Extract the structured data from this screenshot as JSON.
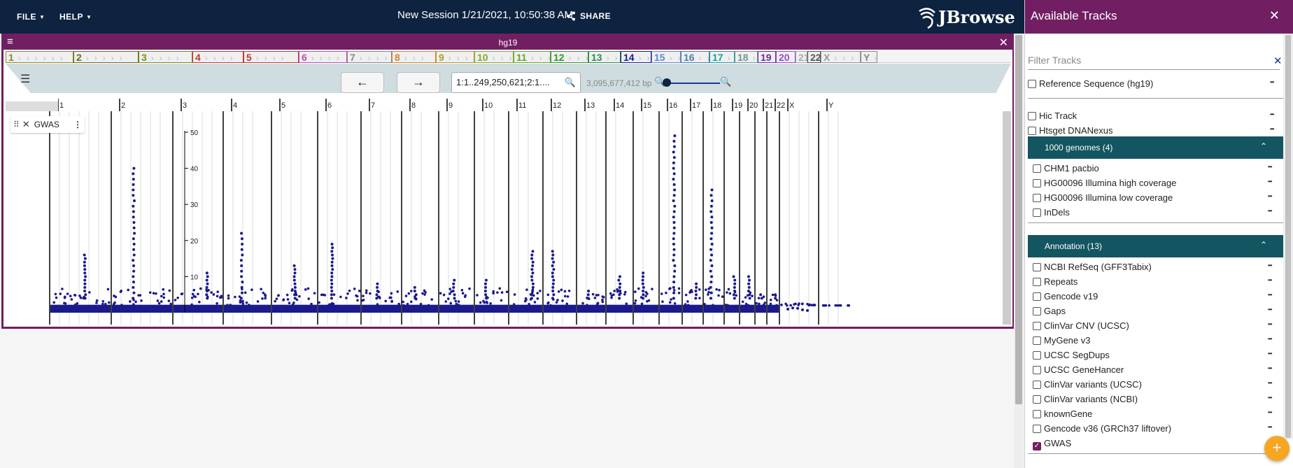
{
  "header": {
    "file_menu": "FILE",
    "help_menu": "HELP",
    "session_title": "New Session 1/21/2021, 10:50:38 AM",
    "share_label": "SHARE",
    "logo_text": "JBrowse",
    "colors": {
      "header_bg": "#0d233f",
      "accent": "#721e63",
      "teal": "#135560",
      "fab": "#f5a623"
    }
  },
  "view": {
    "assembly": "hg19",
    "location": "1:1..249,250,621;2:1....",
    "bp_count": "3,095,677,412 bp",
    "track_label": "GWAS",
    "chromosomes": [
      "1",
      "2",
      "3",
      "4",
      "5",
      "6",
      "7",
      "8",
      "9",
      "10",
      "11",
      "12",
      "13",
      "14",
      "15",
      "16",
      "17",
      "18",
      "19",
      "20",
      "21",
      "22",
      "X",
      "Y"
    ],
    "chromosome_colors": [
      "#8b8b2e",
      "#6b6b1a",
      "#7b8b1a",
      "#c0392b",
      "#c0392b",
      "#c44bb8",
      "#888888",
      "#d9822b",
      "#b59a2a",
      "#8aa82a",
      "#6aa82a",
      "#2e9a2e",
      "#2e8b57",
      "#1a1a9c",
      "#5b8bd0",
      "#4a7fb0",
      "#1aa0a0",
      "#6a9a9a",
      "#6a2ea0",
      "#9a4ad0",
      "#aaaaaa",
      "#555555",
      "#999999",
      "#888888"
    ]
  },
  "drawer": {
    "title": "Available Tracks",
    "filter_placeholder": "Filter Tracks",
    "top_tracks": [
      "Reference Sequence (hg19)"
    ],
    "misc_tracks": [
      "Hic Track",
      "Htsget DNANexus"
    ],
    "categories": [
      {
        "name": "1000 genomes (4)",
        "tracks": [
          "CHM1 pacbio",
          "HG00096 Illumina high coverage",
          "HG00096 Illumina low coverage",
          "InDels"
        ]
      },
      {
        "name": "Annotation (13)",
        "tracks": [
          "NCBI RefSeq (GFF3Tabix)",
          "Repeats",
          "Gencode v19",
          "Gaps",
          "ClinVar CNV (UCSC)",
          "MyGene v3",
          "UCSC SegDups",
          "UCSC GeneHancer",
          "ClinVar variants (UCSC)",
          "ClinVar variants (NCBI)",
          "knownGene",
          "Gencode v36 (GRCh37 liftover)",
          "GWAS"
        ]
      }
    ],
    "checked_track": "GWAS"
  },
  "chart_data": {
    "type": "scatter",
    "title": "",
    "ylabel": "",
    "ylim": [
      0,
      50
    ],
    "y_ticks": [
      10,
      20,
      30,
      40,
      50
    ],
    "chromosome_peaks": [
      {
        "chr": "1",
        "max": 16
      },
      {
        "chr": "2",
        "max": 40
      },
      {
        "chr": "3",
        "max": 11
      },
      {
        "chr": "4",
        "max": 23
      },
      {
        "chr": "5",
        "max": 13
      },
      {
        "chr": "6",
        "max": 19
      },
      {
        "chr": "7",
        "max": 8
      },
      {
        "chr": "8",
        "max": 7
      },
      {
        "chr": "9",
        "max": 9
      },
      {
        "chr": "10",
        "max": 9
      },
      {
        "chr": "11",
        "max": 17
      },
      {
        "chr": "12",
        "max": 17
      },
      {
        "chr": "13",
        "max": 6
      },
      {
        "chr": "14",
        "max": 10
      },
      {
        "chr": "15",
        "max": 11
      },
      {
        "chr": "16",
        "max": 49
      },
      {
        "chr": "17",
        "max": 8
      },
      {
        "chr": "18",
        "max": 34
      },
      {
        "chr": "19",
        "max": 10
      },
      {
        "chr": "20",
        "max": 10
      },
      {
        "chr": "21",
        "max": 5
      },
      {
        "chr": "22",
        "max": 5
      },
      {
        "chr": "X",
        "max": 1
      },
      {
        "chr": "Y",
        "max": 0
      }
    ]
  }
}
